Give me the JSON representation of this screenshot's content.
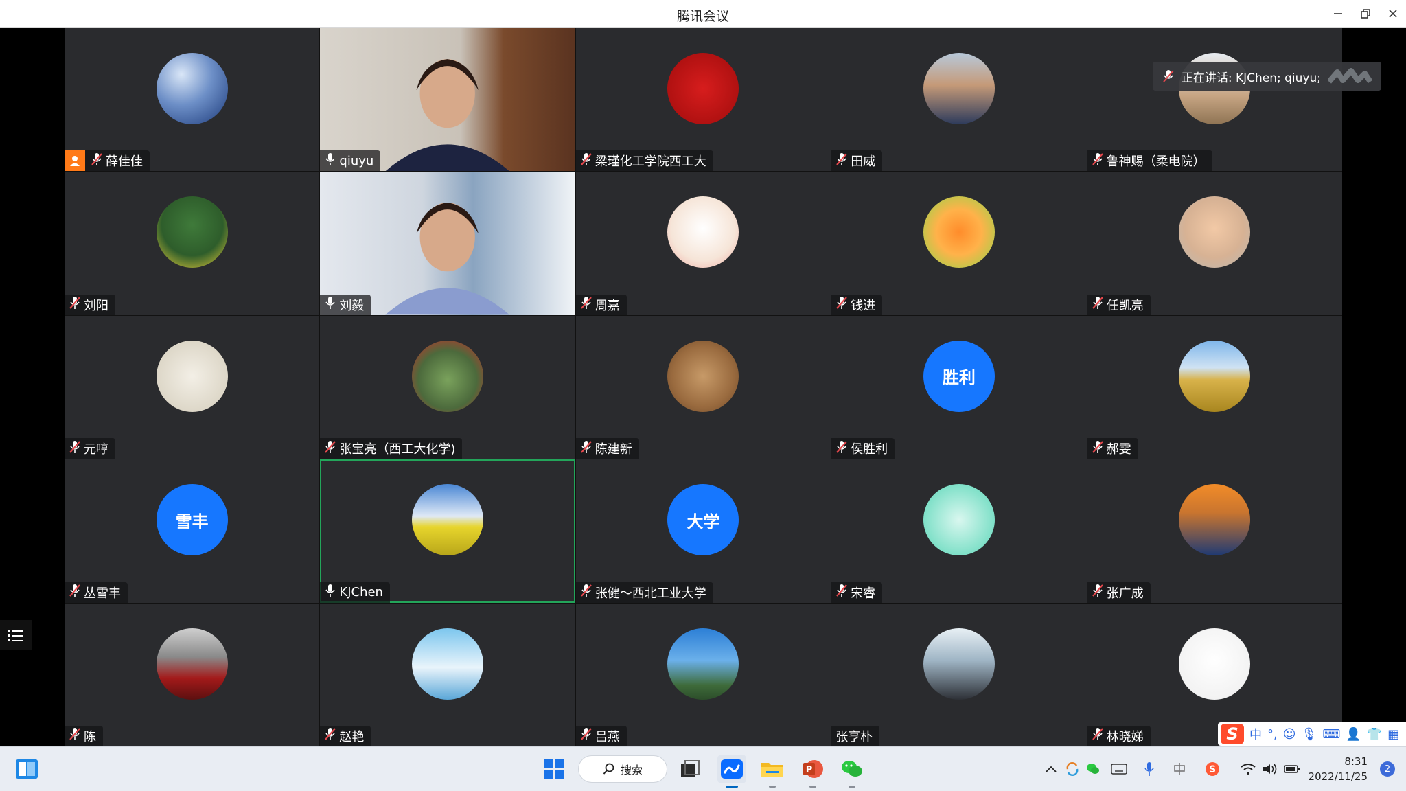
{
  "window": {
    "title": "腾讯会议"
  },
  "speaking": {
    "text": "正在讲话: KJChen; qiuyu;"
  },
  "participants": [
    {
      "name": "薛佳佳",
      "avatar": "moon-photo",
      "host": true,
      "mic": "muted"
    },
    {
      "name": "qiuyu",
      "avatar": "video",
      "mic": "on"
    },
    {
      "name": "梁瑾化工学院西工大",
      "avatar": "cartoon-red",
      "mic": "muted"
    },
    {
      "name": "田威",
      "avatar": "man-photo",
      "mic": "muted"
    },
    {
      "name": "鲁神赐（柔电院）",
      "avatar": "kids-photo",
      "mic": "muted"
    },
    {
      "name": "刘阳",
      "avatar": "cartoon-hood",
      "mic": "muted"
    },
    {
      "name": "刘毅",
      "avatar": "video",
      "mic": "on"
    },
    {
      "name": "周嘉",
      "avatar": "cartoon-girl",
      "mic": "muted"
    },
    {
      "name": "钱进",
      "avatar": "cartoon-monkey",
      "mic": "muted"
    },
    {
      "name": "任凯亮",
      "avatar": "boy-photo",
      "mic": "muted"
    },
    {
      "name": "元哼",
      "avatar": "ink-painting",
      "mic": "muted"
    },
    {
      "name": "张宝亮（西工大化学)",
      "avatar": "person-photo",
      "mic": "muted"
    },
    {
      "name": "陈建新",
      "avatar": "wood-carving",
      "mic": "muted"
    },
    {
      "name": "侯胜利",
      "avatar_text": "胜利",
      "mic": "muted"
    },
    {
      "name": "郝雯",
      "avatar": "field-photo",
      "mic": "muted"
    },
    {
      "name": "丛雪丰",
      "avatar_text": "雪丰",
      "mic": "muted"
    },
    {
      "name": "KJChen",
      "avatar": "flower-field",
      "mic": "on",
      "active": true
    },
    {
      "name": "张健～西北工业大学",
      "avatar_text": "大学",
      "mic": "muted"
    },
    {
      "name": "宋睿",
      "avatar": "cartoon-kid",
      "mic": "muted"
    },
    {
      "name": "张广成",
      "avatar": "speaker-photo",
      "mic": "muted"
    },
    {
      "name": "陈",
      "avatar": "woman-red",
      "mic": "muted"
    },
    {
      "name": "赵艳",
      "avatar": "wedding-photo",
      "mic": "muted"
    },
    {
      "name": "吕燕",
      "avatar": "coast-photo",
      "mic": "muted"
    },
    {
      "name": "张亨朴",
      "avatar": "old-man-photo",
      "mic": "none"
    },
    {
      "name": "林晓娣",
      "avatar": "white-object",
      "mic": "muted"
    }
  ],
  "taskbar": {
    "search_label": "搜索",
    "time": "8:31",
    "date": "2022/11/25",
    "notification_count": "2"
  },
  "ime": {
    "mode": "中"
  }
}
